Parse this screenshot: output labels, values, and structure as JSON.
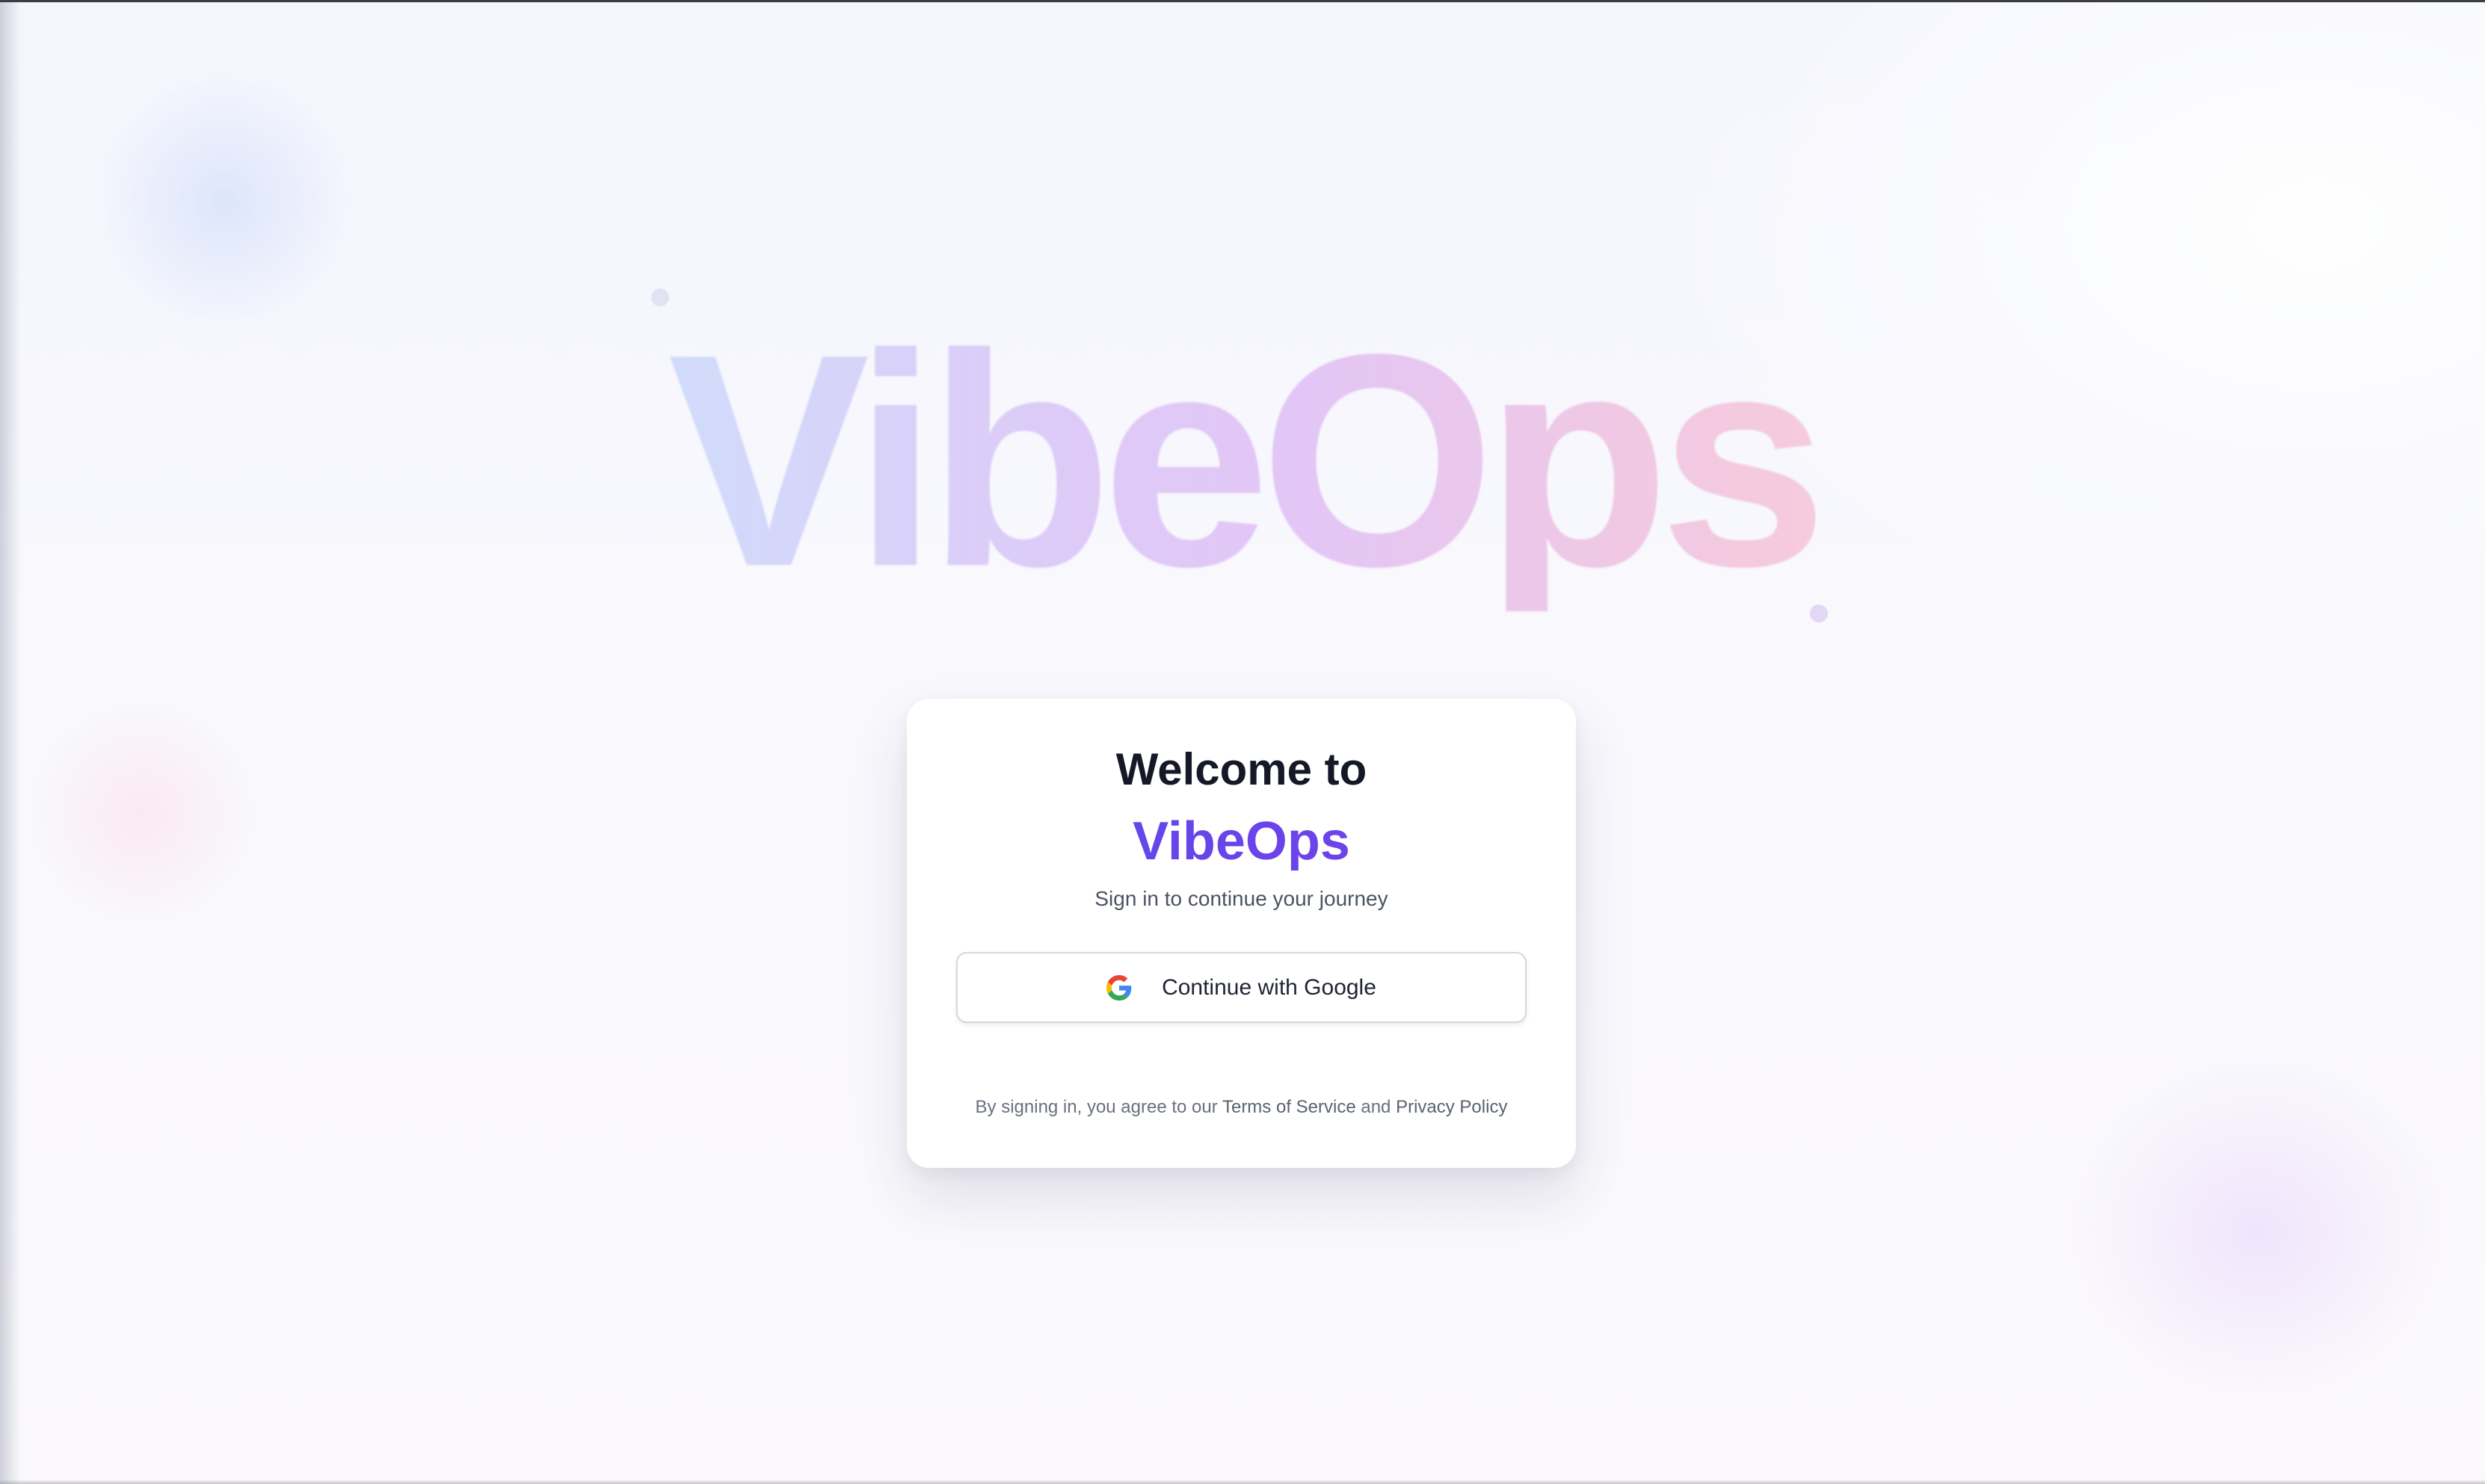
{
  "hero": {
    "wordmark": "VibeOps"
  },
  "card": {
    "title": "Welcome to",
    "brand": "VibeOps",
    "subtitle": "Sign in to continue your journey",
    "google_button_label": "Continue with Google",
    "google_icon": "google-g-icon",
    "legal_prefix": "By signing in, you agree to our ",
    "terms_link": "Terms of Service",
    "legal_and": " and ",
    "privacy_link": "Privacy Policy"
  },
  "colors": {
    "brand_accent": "#6a44ea",
    "title_text": "#141827",
    "page_background": "#f8f8fd",
    "card_background": "#ffffff"
  }
}
